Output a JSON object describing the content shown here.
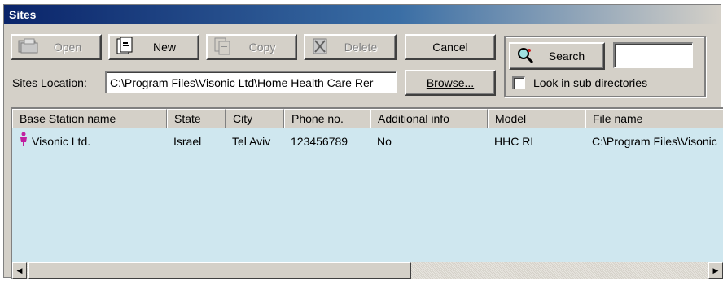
{
  "window": {
    "title": "Sites"
  },
  "toolbar": {
    "open_label": "Open",
    "new_label": "New",
    "copy_label": "Copy",
    "delete_label": "Delete",
    "cancel_label": "Cancel",
    "browse_label": "Browse..."
  },
  "location": {
    "label": "Sites Location:",
    "value": "C:\\Program Files\\Visonic Ltd\\Home Health Care Rer"
  },
  "search": {
    "button_label": "Search",
    "query": "",
    "subdir_label": "Look in sub directories",
    "subdir_checked": false
  },
  "table": {
    "columns": [
      "Base Station name",
      "State",
      "City",
      "Phone no.",
      "Additional info",
      "Model",
      "File name"
    ],
    "rows": [
      {
        "name": "Visonic Ltd.",
        "state": "Israel",
        "city": "Tel Aviv",
        "phone": "123456789",
        "info": "No",
        "model": "HHC RL",
        "file": "C:\\Program Files\\Visonic"
      }
    ]
  },
  "icons": {
    "open": "folder-open-icon",
    "new": "new-document-icon",
    "copy": "copy-icon",
    "delete": "delete-icon",
    "search": "magnifier-icon",
    "row": "person-icon",
    "scroll_left": "arrow-left-icon",
    "scroll_right": "arrow-right-icon"
  },
  "colors": {
    "title_start": "#0a246a",
    "title_end": "#d4d0c8",
    "grid_bg": "#cfe7ef",
    "face": "#d4d0c8",
    "person": "#c020a0"
  }
}
